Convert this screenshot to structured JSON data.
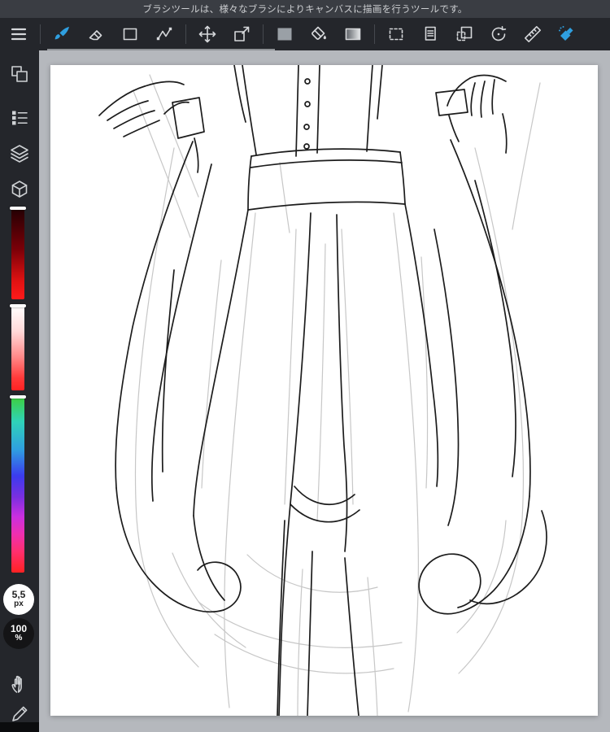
{
  "message_bar": {
    "text": "ブラシツールは、様々なブラシによりキャンバスに描画を行うツールです。"
  },
  "toolbar": {
    "active_tool": "brush",
    "accent_color": "#2f9fe0",
    "tools": [
      {
        "name": "menu"
      },
      {
        "name": "brush"
      },
      {
        "name": "eraser"
      },
      {
        "name": "shape"
      },
      {
        "name": "polyline"
      },
      {
        "name": "move"
      },
      {
        "name": "transform"
      },
      {
        "name": "color-swatch"
      },
      {
        "name": "bucket"
      },
      {
        "name": "gradient"
      },
      {
        "name": "select"
      },
      {
        "name": "copy"
      },
      {
        "name": "paste"
      },
      {
        "name": "rotate"
      },
      {
        "name": "ruler"
      },
      {
        "name": "airbrush"
      }
    ]
  },
  "sidebar": {
    "panel_icons": [
      "color-pair",
      "layer-list",
      "layers",
      "materials"
    ],
    "sliders": [
      {
        "name": "shade",
        "colors": [
          "#230003",
          "#7a0008",
          "#e01212",
          "#ff1a1a"
        ]
      },
      {
        "name": "tint",
        "colors": [
          "#ffffff",
          "#ff8a8a",
          "#ff2222"
        ]
      },
      {
        "name": "hue",
        "colors": [
          "#3ecf3e",
          "#2fd3b8",
          "#2f9fe0",
          "#3b3bee",
          "#7a2fe0",
          "#c92fe0",
          "#ee2fb0",
          "#ff2f6e",
          "#ff2222"
        ]
      }
    ],
    "brush_size": {
      "value": "5,5",
      "unit": "px"
    },
    "zoom": {
      "value": "100",
      "unit": "%"
    },
    "extra_tools": [
      "hand",
      "stylus"
    ]
  },
  "canvas": {
    "background": "#b5b8bd",
    "paper_color": "#ffffff",
    "content": "rough pencil line sketch of a figure in a buttoned shirt and long skirt, both hands lifting the fabric at the sides"
  }
}
